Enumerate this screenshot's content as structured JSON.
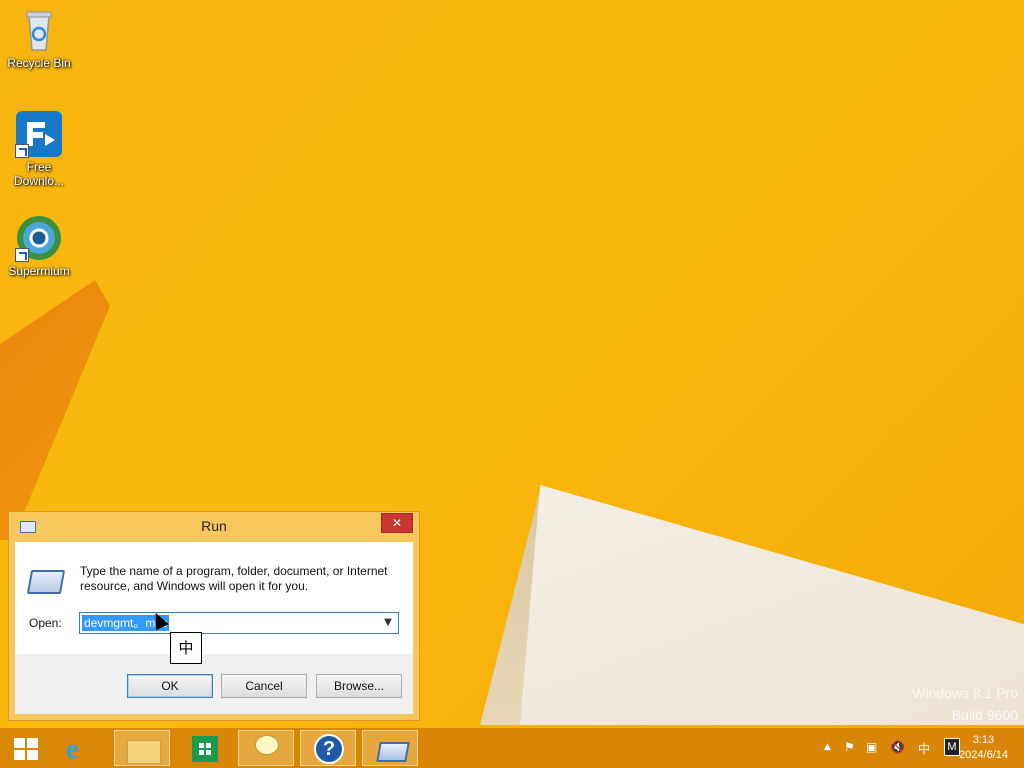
{
  "desktop": {
    "icons": [
      {
        "label": "Recycle Bin",
        "icon": "recycle-bin-icon"
      },
      {
        "label": "Free Downlo...",
        "icon": "free-download-manager-icon"
      },
      {
        "label": "Supermium",
        "icon": "supermium-browser-icon"
      }
    ],
    "watermark": {
      "line1": "Windows 8.1 Pro",
      "line2": "Build 9600"
    }
  },
  "run_dialog": {
    "title": "Run",
    "description": "Type the name of a program, folder, document, or Internet resource, and Windows will open it for you.",
    "open_label": "Open:",
    "open_value": "devmgmt。msc",
    "ime_candidate": "中",
    "buttons": {
      "ok": "OK",
      "cancel": "Cancel",
      "browse": "Browse..."
    }
  },
  "taskbar": {
    "items": [
      "start",
      "internet-explorer",
      "file-explorer",
      "store",
      "notification",
      "help",
      "run"
    ],
    "help_glyph": "?",
    "tray": {
      "ime_lang": "中",
      "ime_mode": "M",
      "time": "3:13",
      "date": "2024/6/14"
    }
  },
  "colors": {
    "wallpaper": "#f7b40f",
    "taskbar": "#d68208",
    "close_button": "#c7372f",
    "selection": "#3399ff"
  }
}
